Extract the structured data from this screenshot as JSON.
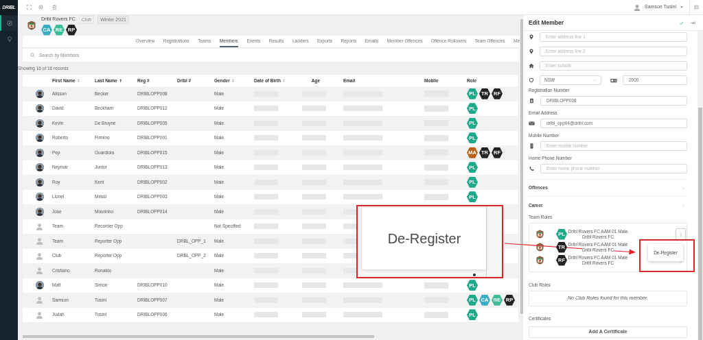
{
  "app": {
    "logo": "DRIBL"
  },
  "sidebar": {
    "items": [
      {
        "selected": true
      },
      {
        "selected": false
      }
    ]
  },
  "user_menu": {
    "name": "Samson Tusini"
  },
  "club": {
    "name": "Dribl Rovers FC",
    "type": "Club",
    "season": "Winter 2021",
    "roles": [
      {
        "label": "CA",
        "color": "#3aaec4"
      },
      {
        "label": "RE",
        "color": "#3dbb98"
      },
      {
        "label": "RP",
        "color": "#222222"
      }
    ]
  },
  "nav_tabs": [
    {
      "label": "Overview",
      "selected": false
    },
    {
      "label": "Registrations",
      "selected": false
    },
    {
      "label": "Teams",
      "selected": false
    },
    {
      "label": "Members",
      "selected": true
    },
    {
      "label": "Events",
      "selected": false
    },
    {
      "label": "Results",
      "selected": false
    },
    {
      "label": "Ladders",
      "selected": false
    },
    {
      "label": "Exports",
      "selected": false
    },
    {
      "label": "Reports",
      "selected": false
    },
    {
      "label": "Emails",
      "selected": false
    },
    {
      "label": "Member Offences",
      "selected": false
    },
    {
      "label": "Offence Rollovers",
      "selected": false
    },
    {
      "label": "Team Offences",
      "selected": false
    },
    {
      "label": "Me",
      "selected": false
    }
  ],
  "search": {
    "placeholder": "Search by Members"
  },
  "record_count": "Showing 16 of 16 records",
  "table": {
    "columns": [
      {
        "label": "First Name",
        "sortable": true,
        "sorted_ascending": false
      },
      {
        "label": "Last Name",
        "sortable": true,
        "sorted_ascending": true
      },
      {
        "label": "Reg #",
        "sortable": false,
        "sorted_ascending": false
      },
      {
        "label": "Dribl #",
        "sortable": false,
        "sorted_ascending": false
      },
      {
        "label": "Gender",
        "sortable": true,
        "sorted_ascending": false
      },
      {
        "label": "Date of Birth",
        "sortable": true,
        "sorted_ascending": false
      },
      {
        "label": "Age",
        "sortable": false,
        "sorted_ascending": false
      },
      {
        "label": "Email",
        "sortable": false,
        "sorted_ascending": false
      },
      {
        "label": "Mobile",
        "sortable": false,
        "sorted_ascending": false
      },
      {
        "label": "Role",
        "sortable": false,
        "sorted_ascending": false
      }
    ],
    "rows": [
      {
        "has_photo": true,
        "first_name": "Alisson",
        "last_name": "Becker",
        "reg": "DRIBLOPP008",
        "gender": "Male",
        "roles": [
          {
            "label": "PL",
            "color": "#1fa98b"
          },
          {
            "label": "TR",
            "color": "#222222"
          },
          {
            "label": "RF",
            "color": "#222222"
          }
        ]
      },
      {
        "has_photo": true,
        "first_name": "David",
        "last_name": "Beckham",
        "reg": "DRIBLOPP012",
        "gender": "Male",
        "roles": [
          {
            "label": "PL",
            "color": "#1fa98b"
          }
        ]
      },
      {
        "has_photo": true,
        "first_name": "Kevin",
        "last_name": "De Bruyne",
        "reg": "DRIBLOPP005",
        "gender": "Male",
        "roles": [
          {
            "label": "PL",
            "color": "#1fa98b"
          }
        ]
      },
      {
        "has_photo": true,
        "first_name": "Roberto",
        "last_name": "Firmino",
        "reg": "DRIBLOPP001",
        "gender": "Male",
        "roles": [
          {
            "label": "PL",
            "color": "#1fa98b"
          }
        ]
      },
      {
        "has_photo": true,
        "first_name": "Pep",
        "last_name": "Guardiola",
        "reg": "DRIBLOPP015",
        "gender": "Male",
        "roles": [
          {
            "label": "MA",
            "color": "#b8621b"
          },
          {
            "label": "TR",
            "color": "#222222"
          },
          {
            "label": "RF",
            "color": "#222222"
          }
        ]
      },
      {
        "has_photo": true,
        "first_name": "Neymar",
        "last_name": "Junior",
        "reg": "DRIBLOPP013",
        "gender": "Male",
        "roles": [
          {
            "label": "PL",
            "color": "#1fa98b"
          }
        ]
      },
      {
        "has_photo": true,
        "first_name": "Roy",
        "last_name": "Kent",
        "reg": "DRIBLOPP002",
        "gender": "Male",
        "roles": [
          {
            "label": "PL",
            "color": "#1fa98b"
          }
        ]
      },
      {
        "has_photo": true,
        "first_name": "Lionel",
        "last_name": "Messi",
        "reg": "DRIBLOPP003",
        "gender": "Male",
        "roles": [
          {
            "label": "PL",
            "color": "#1fa98b"
          }
        ]
      },
      {
        "has_photo": true,
        "first_name": "Jose",
        "last_name": "Mourinho",
        "reg": "DRIBLOPP014",
        "gender": "Male"
      },
      {
        "has_photo": false,
        "first_name": "Team",
        "last_name": "Recorder Opp",
        "gender": "Not Specified"
      },
      {
        "has_photo": false,
        "first_name": "Team",
        "last_name": "Reporter Opp",
        "dribl": "DRBL_OPP_1",
        "gender": "Male"
      },
      {
        "has_photo": false,
        "first_name": "Club",
        "last_name": "Reporter Opp",
        "dribl": "DRBL_OPP_2",
        "gender": "Male"
      },
      {
        "has_photo": false,
        "first_name": "Cristiano",
        "last_name": "Ronaldo",
        "gender": "Male"
      },
      {
        "has_photo": true,
        "first_name": "Matt",
        "last_name": "Simon",
        "reg": "DRIBLOPP010",
        "gender": "Male",
        "roles": [
          {
            "label": "PL",
            "color": "#1fa98b"
          }
        ]
      },
      {
        "has_photo": false,
        "first_name": "Samson",
        "last_name": "Tusini",
        "reg": "DRIBLOPP007",
        "gender": "Male",
        "roles": [
          {
            "label": "PL",
            "color": "#1fa98b"
          },
          {
            "label": "CA",
            "color": "#3aaec4"
          },
          {
            "label": "RE",
            "color": "#3dbb98"
          },
          {
            "label": "RP",
            "color": "#222222"
          }
        ]
      },
      {
        "has_photo": false,
        "first_name": "Judah",
        "last_name": "Tusini",
        "reg": "DRIBLOPP006",
        "gender": "Male",
        "roles": [
          {
            "label": "PL",
            "color": "#1fa98b"
          }
        ]
      }
    ]
  },
  "edit_member": {
    "title": "Edit Member",
    "address_fields": [
      {
        "placeholder": "Enter address line 1"
      },
      {
        "placeholder": "Enter address line 2"
      },
      {
        "placeholder": "Enter suburb"
      }
    ],
    "state_select": {
      "value": "NSW"
    },
    "postcode": {
      "value": "2000"
    },
    "contact_fields": [
      {
        "label": "Registration Number",
        "value": "DRIBLOPP008"
      },
      {
        "label": "Email Address",
        "value": "dribl_opp04@dribl.com"
      },
      {
        "label": "Mobile Number",
        "placeholder": "Enter mobile number"
      },
      {
        "label": "Home Phone Number",
        "placeholder": "Enter home phone number"
      }
    ],
    "sections": [
      {
        "label": "Offences"
      },
      {
        "label": "Career"
      }
    ],
    "team_roles": {
      "label": "Team Roles",
      "items": [
        {
          "role": {
            "label": "PL",
            "color": "#1fa98b"
          },
          "team": "Dribl Rovers FC AAM 01 Male",
          "club": "Dribl Rovers FC",
          "menu_open": true
        },
        {
          "role": {
            "label": "TR",
            "color": "#222222"
          },
          "team": "Dribl Rovers FC AAM 01 Male",
          "club": "Dribl Rovers FC",
          "menu_open": false
        },
        {
          "role": {
            "label": "RF",
            "color": "#222222"
          },
          "team": "Dribl Rovers FC AAM 01 Male",
          "club": "Dribl Rovers FC",
          "menu_open": false
        }
      ]
    },
    "role_menu": {
      "items": [
        "De-Register"
      ]
    },
    "club_roles": {
      "label": "Club Roles",
      "empty_text": "No Club Roles found for this member."
    },
    "certificates": {
      "label": "Certificates",
      "button": "Add A Certificate"
    }
  },
  "callout": {
    "text": "De-Register"
  }
}
